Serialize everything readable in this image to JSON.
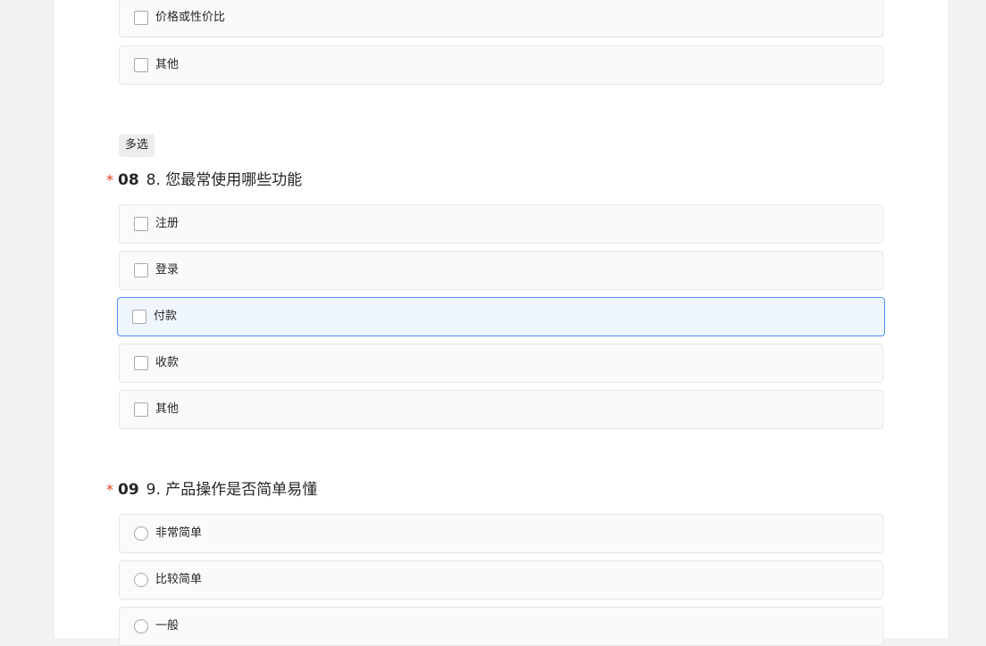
{
  "q7": {
    "options": [
      "价格或性价比",
      "其他"
    ]
  },
  "q8": {
    "type_tag": "多选",
    "required_mark": "*",
    "number": "08",
    "title": "8. 您最常使用哪些功能",
    "options": [
      "注册",
      "登录",
      "付款",
      "收款",
      "其他"
    ]
  },
  "q9": {
    "required_mark": "*",
    "number": "09",
    "title": "9. 产品操作是否简单易懂",
    "options": [
      "非常简单",
      "比较简单",
      "一般"
    ]
  },
  "colors": {
    "page_bg": "#f2f2f2",
    "required": "#e0401c",
    "hover_border": "#4f8ff7",
    "hover_bg": "#f0f6ff"
  }
}
